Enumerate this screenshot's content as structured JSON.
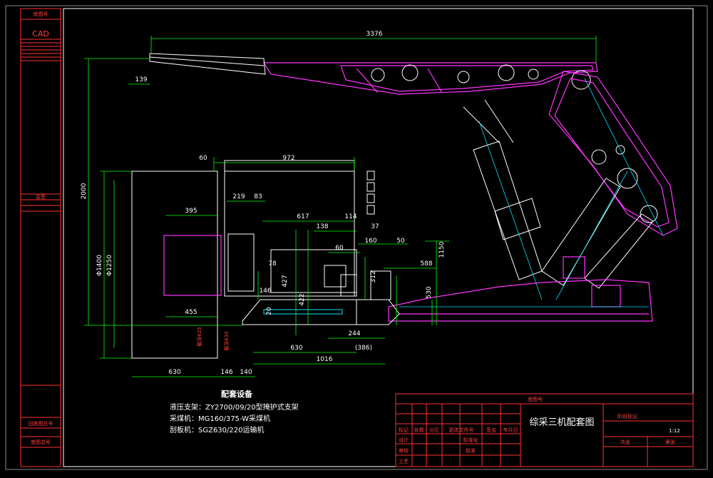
{
  "colors": {
    "background": "#000000",
    "frame": "#ffffff",
    "border_red": "#ff3030",
    "magenta": "#ff33ff",
    "white": "#ffffff",
    "green": "#00ff00",
    "cyan": "#00e5ff",
    "yellow": "#ffff00"
  },
  "left_strip": {
    "top_label": "底图号",
    "cad_label": "CAD",
    "mid_label": "会签",
    "label_3": "旧底图总号",
    "label_4": "底图总号"
  },
  "dimensions": {
    "d3376": "3376",
    "d139": "139",
    "d2000": "2000",
    "d60": "60",
    "d972": "972",
    "d219": "219",
    "d83": "83",
    "d395": "395",
    "d617": "617",
    "d114": "114",
    "d138": "138",
    "d37": "37",
    "d160": "160",
    "d50": "50",
    "d60b": "60",
    "d1150": "1150",
    "d1400": "Φ1400",
    "d1250": "Φ1250",
    "d78": "78",
    "d427": "427",
    "d422": "422",
    "d312": "312",
    "d588": "588",
    "d530": "530",
    "d146a": "146",
    "d20": "20",
    "d455": "455",
    "d244": "244",
    "d386": "(386)",
    "d630a": "630",
    "d1016": "1016",
    "d630b": "630",
    "d146b": "146",
    "d140": "140",
    "v_label1": "截深625",
    "v_label2": "截深630"
  },
  "notes": {
    "title": "配套设备",
    "lines": [
      "液压支架：ZY2700/09/20型掩护式支架",
      "采煤机：MG160/375-W采煤机",
      "刮板机：SGZ630/220运输机"
    ]
  },
  "title_block": {
    "drawing_number_label": "底图号",
    "title": "综采三机配套图",
    "stage_header": "阶段标记",
    "scale_value": "1:12",
    "row1": [
      "标记",
      "处数",
      "分区",
      "更改文件号",
      "签名",
      "年月日"
    ],
    "row2": [
      "设计",
      "",
      "标准化"
    ],
    "row3": [
      "审核",
      "",
      "批准"
    ],
    "row4": [
      "工艺"
    ],
    "sheet_a": "共张",
    "sheet_b": "第张"
  }
}
